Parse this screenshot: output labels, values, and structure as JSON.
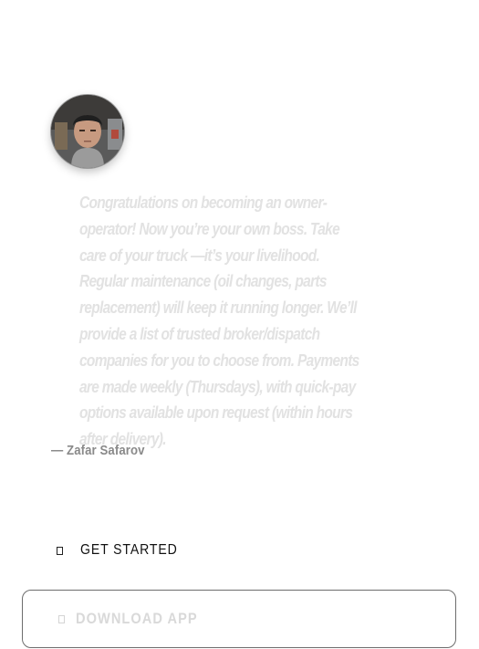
{
  "testimonial": {
    "avatar_icon": "person-photo-icon",
    "quote_text": "Congratulations on becoming an owner-operator! Now you’re your own boss. Take care of your truck —it’s your livelihood. Regular maintenance (oil changes, parts replacement) will keep it running longer. We’ll provide a list of trusted broker/dispatch companies for you to choose from. Payments are made weekly (Thursdays), with quick-pay options available upon request (within hours after delivery).",
    "author": "— Zafar Safarov"
  },
  "actions": {
    "get_started_label": "GET STARTED",
    "get_started_icon": "square-icon",
    "download_app_label": "DOWNLOAD APP",
    "download_app_icon": "square-icon"
  },
  "colors": {
    "quote_text": "#e2e2e2",
    "author_text": "#8a8a8a",
    "primary_text": "#111111",
    "button_border": "#6d6d6d",
    "disabled_text": "#d9d9d9"
  }
}
